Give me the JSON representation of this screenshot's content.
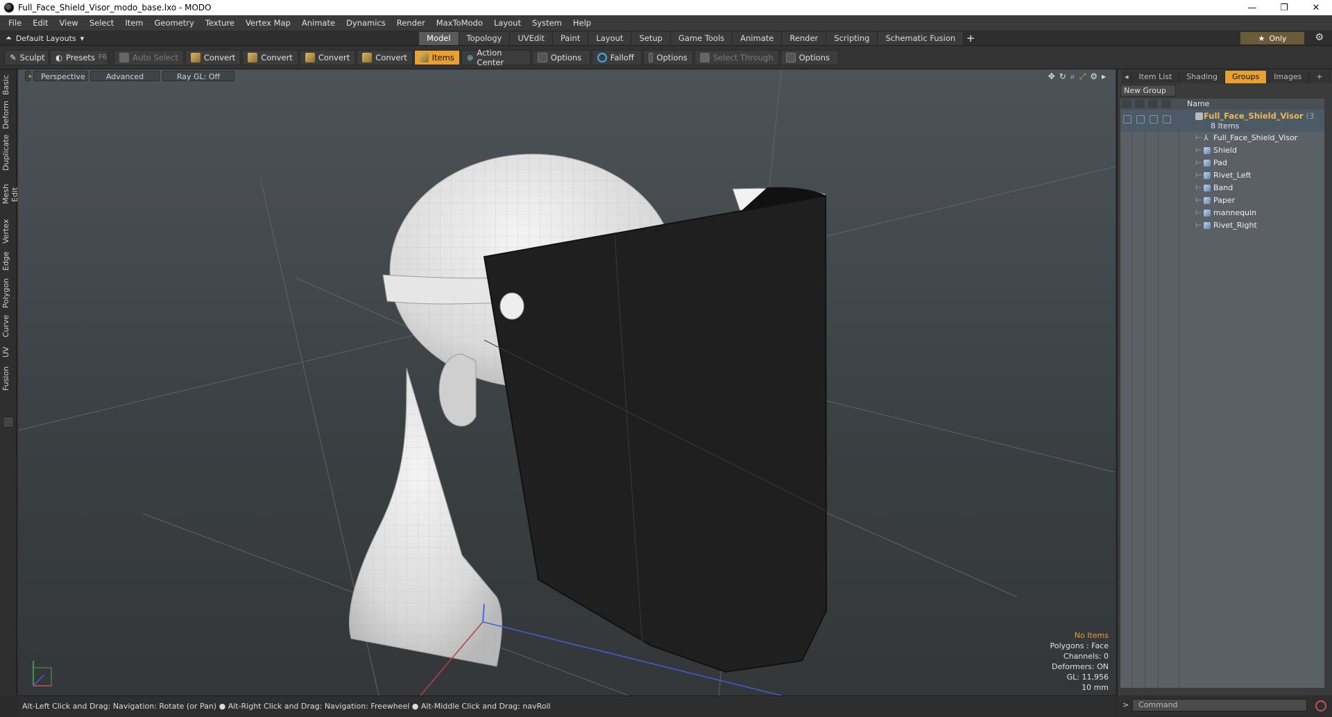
{
  "window": {
    "title": "Full_Face_Shield_Visor_modo_base.lxo - MODO",
    "minimize": "—",
    "maximize": "❐",
    "close": "✕"
  },
  "menu": [
    "File",
    "Edit",
    "View",
    "Select",
    "Item",
    "Geometry",
    "Texture",
    "Vertex Map",
    "Animate",
    "Dynamics",
    "Render",
    "MaxToModo",
    "Layout",
    "System",
    "Help"
  ],
  "layout_selector": "Default Layouts",
  "mode_tabs": [
    {
      "label": "Model",
      "active": true
    },
    {
      "label": "Topology",
      "active": false
    },
    {
      "label": "UVEdit",
      "active": false
    },
    {
      "label": "Paint",
      "active": false
    },
    {
      "label": "Layout",
      "active": false
    },
    {
      "label": "Setup",
      "active": false
    },
    {
      "label": "Game Tools",
      "active": false
    },
    {
      "label": "Animate",
      "active": false
    },
    {
      "label": "Render",
      "active": false
    },
    {
      "label": "Scripting",
      "active": false
    },
    {
      "label": "Schematic Fusion",
      "active": false
    }
  ],
  "only_label": "Only",
  "toolbar": {
    "sculpt": "Sculpt",
    "presets": "Presets",
    "presets_key": "F6",
    "auto_select": "Auto Select",
    "convert1": "Convert",
    "convert2": "Convert",
    "convert3": "Convert",
    "convert4": "Convert",
    "items": "Items",
    "action_center": "Action Center",
    "options1": "Options",
    "falloff": "Falloff",
    "options2": "Options",
    "select_through": "Select Through",
    "options3": "Options"
  },
  "left_tabs": [
    "Basic",
    "Deform",
    "Duplicate",
    "Mesh Edit",
    "Vertex",
    "Edge",
    "Polygon",
    "Curve",
    "UV",
    "Fusion"
  ],
  "viewport": {
    "view": "Perspective",
    "shading": "Advanced",
    "raygl": "Ray GL: Off",
    "info": {
      "selection": "No Items",
      "polygons": "Polygons : Face",
      "channels": "Channels: 0",
      "deformers": "Deformers: ON",
      "gl": "GL: 11,956",
      "scale": "10 mm"
    }
  },
  "right_panel": {
    "tabs": [
      {
        "label": "Item List",
        "active": false
      },
      {
        "label": "Shading",
        "active": false
      },
      {
        "label": "Groups",
        "active": true
      },
      {
        "label": "Images",
        "active": false
      },
      {
        "label": "+",
        "active": false
      }
    ],
    "new_group": "New Group",
    "name_header": "Name",
    "group": {
      "name": "Full_Face_Shield_Visor",
      "suffix": "(3",
      "count": "8 Items"
    },
    "items": [
      "Full_Face_Shield_Visor",
      "Shield",
      "Pad",
      "Rivet_Left",
      "Band",
      "Paper",
      "mannequin",
      "Rivet_Right"
    ]
  },
  "status": "Alt-Left Click and Drag: Navigation: Rotate (or Pan) ● Alt-Right Click and Drag: Navigation: Freewheel ● Alt-Middle Click and Drag: navRoll",
  "command_placeholder": "Command"
}
